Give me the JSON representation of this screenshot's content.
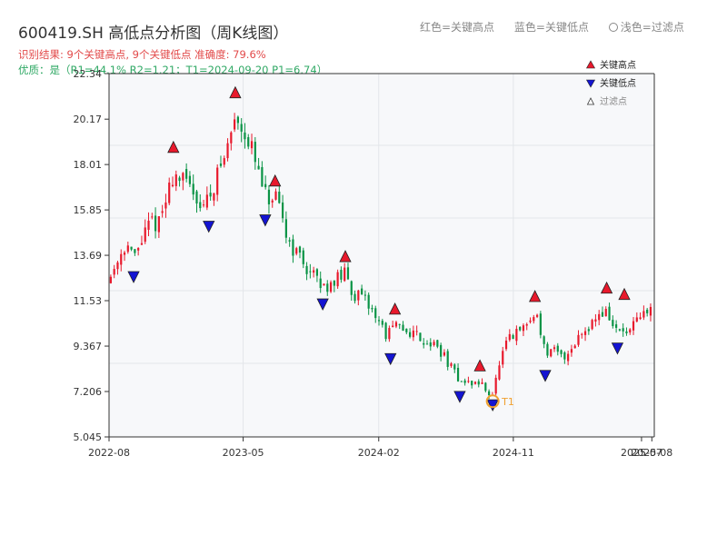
{
  "header": {
    "title": "600419.SH 高低点分析图（周K线图）",
    "legend_red": "红色=关键高点",
    "legend_blue": "蓝色=关键低点",
    "legend_filtered": "浅色=过滤点",
    "result": "识别结果: 9个关键高点, 9个关键低点  准确度: 79.6%",
    "quality": "优质：是（R1=44.1%  R2=1.21；T1=2024-09-20 P1=6.74）"
  },
  "colors": {
    "up": "#e8192c",
    "down": "#0a9345",
    "high_marker": "#e8192c",
    "low_marker": "#1414d2",
    "t1": "#f0a030",
    "plot_bg": "#f7f8fa",
    "grid": "#e3e6ea"
  },
  "chart_data": {
    "type": "candlestick",
    "y_ticks": [
      "5.045",
      "7.206",
      "9.367",
      "11.53",
      "13.69",
      "15.85",
      "18.01",
      "20.17",
      "22.34"
    ],
    "ylim": [
      5.045,
      22.34
    ],
    "x_ticks": [
      "2022-08",
      "2023-05",
      "2024-02",
      "2024-11",
      "2025-07",
      "2025-08"
    ],
    "xlim": [
      "2022-08-01",
      "2025-08-15"
    ],
    "grid": true,
    "legend_position": "top-right",
    "legend": [
      {
        "label": "关键高点",
        "kind": "high"
      },
      {
        "label": "关键低点",
        "kind": "low"
      },
      {
        "label": "过滤点",
        "kind": "filtered"
      }
    ],
    "key_highs": [
      {
        "date": "2022-12-10",
        "price": 18.5
      },
      {
        "date": "2023-04-15",
        "price": 21.1
      },
      {
        "date": "2023-07-05",
        "price": 16.9
      },
      {
        "date": "2023-11-25",
        "price": 13.3
      },
      {
        "date": "2024-03-05",
        "price": 10.8
      },
      {
        "date": "2024-08-25",
        "price": 8.1
      },
      {
        "date": "2024-12-15",
        "price": 11.4
      },
      {
        "date": "2025-05-10",
        "price": 11.8
      },
      {
        "date": "2025-06-15",
        "price": 11.5
      }
    ],
    "key_lows": [
      {
        "date": "2022-09-20",
        "price": 13.0
      },
      {
        "date": "2023-02-20",
        "price": 15.4
      },
      {
        "date": "2023-06-15",
        "price": 15.7
      },
      {
        "date": "2023-10-10",
        "price": 11.7
      },
      {
        "date": "2024-02-25",
        "price": 9.1
      },
      {
        "date": "2024-07-15",
        "price": 7.3
      },
      {
        "date": "2024-09-20",
        "price": 6.9
      },
      {
        "date": "2025-01-05",
        "price": 8.3
      },
      {
        "date": "2025-06-01",
        "price": 9.6
      }
    ],
    "t1": {
      "label": "T1",
      "date": "2024-09-20",
      "price": 6.74
    },
    "price_path": [
      [
        "2022-08-01",
        12.5
      ],
      [
        "2022-08-20",
        13.6
      ],
      [
        "2022-09-05",
        14.3
      ],
      [
        "2022-09-20",
        13.5
      ],
      [
        "2022-10-10",
        14.6
      ],
      [
        "2022-10-25",
        15.3
      ],
      [
        "2022-11-10",
        15.2
      ],
      [
        "2022-11-25",
        16.3
      ],
      [
        "2022-12-10",
        17.6
      ],
      [
        "2022-12-30",
        17.2
      ],
      [
        "2023-01-20",
        16.8
      ],
      [
        "2023-02-05",
        16.0
      ],
      [
        "2023-02-20",
        16.4
      ],
      [
        "2023-03-10",
        17.6
      ],
      [
        "2023-03-25",
        18.4
      ],
      [
        "2023-04-15",
        20.3
      ],
      [
        "2023-05-01",
        19.8
      ],
      [
        "2023-05-20",
        18.6
      ],
      [
        "2023-06-05",
        17.2
      ],
      [
        "2023-06-20",
        16.2
      ],
      [
        "2023-07-05",
        16.4
      ],
      [
        "2023-07-20",
        15.3
      ],
      [
        "2023-08-05",
        14.2
      ],
      [
        "2023-08-25",
        13.6
      ],
      [
        "2023-09-10",
        13.0
      ],
      [
        "2023-09-25",
        12.6
      ],
      [
        "2023-10-10",
        12.1
      ],
      [
        "2023-10-25",
        12.4
      ],
      [
        "2023-11-10",
        12.6
      ],
      [
        "2023-11-25",
        12.8
      ],
      [
        "2023-12-10",
        11.9
      ],
      [
        "2023-12-30",
        11.6
      ],
      [
        "2024-01-15",
        11.2
      ],
      [
        "2024-02-01",
        10.6
      ],
      [
        "2024-02-15",
        9.9
      ],
      [
        "2024-03-05",
        10.3
      ],
      [
        "2024-03-25",
        10.1
      ],
      [
        "2024-04-15",
        10.0
      ],
      [
        "2024-05-05",
        9.6
      ],
      [
        "2024-05-25",
        9.4
      ],
      [
        "2024-06-10",
        9.0
      ],
      [
        "2024-06-25",
        8.4
      ],
      [
        "2024-07-10",
        7.9
      ],
      [
        "2024-07-25",
        7.6
      ],
      [
        "2024-08-10",
        7.6
      ],
      [
        "2024-08-25",
        7.6
      ],
      [
        "2024-09-10",
        7.2
      ],
      [
        "2024-09-20",
        7.1
      ],
      [
        "2024-10-05",
        8.6
      ],
      [
        "2024-10-20",
        9.6
      ],
      [
        "2024-11-05",
        9.9
      ],
      [
        "2024-11-20",
        10.2
      ],
      [
        "2024-12-05",
        10.6
      ],
      [
        "2024-12-20",
        10.9
      ],
      [
        "2025-01-05",
        9.0
      ],
      [
        "2025-01-25",
        9.1
      ],
      [
        "2025-02-10",
        8.8
      ],
      [
        "2025-02-25",
        9.2
      ],
      [
        "2025-03-15",
        9.9
      ],
      [
        "2025-04-05",
        10.4
      ],
      [
        "2025-04-25",
        10.9
      ],
      [
        "2025-05-10",
        11.0
      ],
      [
        "2025-05-25",
        10.2
      ],
      [
        "2025-06-10",
        10.0
      ],
      [
        "2025-06-25",
        10.0
      ],
      [
        "2025-07-10",
        10.5
      ],
      [
        "2025-07-25",
        10.9
      ],
      [
        "2025-08-10",
        11.2
      ]
    ]
  }
}
